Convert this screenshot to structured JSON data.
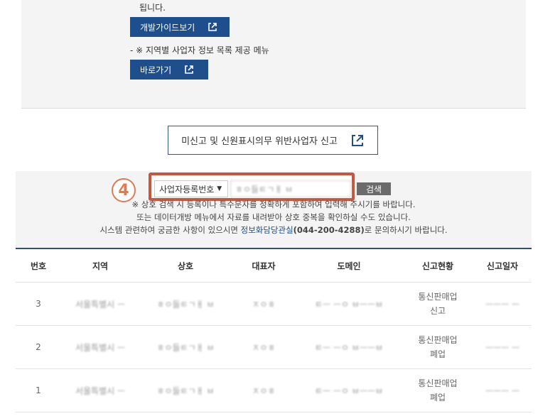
{
  "info": {
    "line_top": "됩니다.",
    "guide_button": "개발가이드보기",
    "list_note": "- ※ 지역별 사업자 정보 목록 제공 메뉴",
    "go_button": "바로가기"
  },
  "report_button": "미신고 및 신원표시의무 위반사업자 신고",
  "search": {
    "step_number": "4",
    "select_value": "사업자등록번호",
    "input_value": "ㅎㅇ들ㅌㄱㅐ ㅂ",
    "button": "검색"
  },
  "notices": [
    "※ 상호 검색 시 등록이나 특수문자를 정확하게 포함하여 입력해 주시기를 바랍니다.",
    "또는 데이터개방 메뉴에서 자료를 내려받아 상호 중복을 확인하실 수도 있습니다."
  ],
  "contact": {
    "prefix": "시스템 관련하여 궁금한 사항이 있으시면 ",
    "link": "정보화담당관실",
    "phone": "(044-200-4288)",
    "suffix": "로 문의하시기 바랍니다."
  },
  "table": {
    "headers": [
      "번호",
      "지역",
      "상호",
      "대표자",
      "도메인",
      "신고현황",
      "신고일자"
    ],
    "rows": [
      {
        "no": "3",
        "region": "서울특별시 ㅡ",
        "name": "ㅎㅇ들ㅌㄱㅐ ㅂ",
        "rep": "ㅈㅇㅎ",
        "domain": "ㅌㅡ ㅡㅇ ㅂㅡㅡㅂ",
        "status1": "통신판매업",
        "status2": "신고",
        "date": "ㅡㅡㅡ ㅡ"
      },
      {
        "no": "2",
        "region": "서울특별시 ㅡ",
        "name": "ㅎㅇ들ㅌㄱㅐ ㅂ",
        "rep": "ㅈㅇㅎ",
        "domain": "ㅌㅡ ㅡㅇ ㅂㅡㅡㅂ",
        "status1": "통신판매업",
        "status2": "폐업",
        "date": "ㅡㅡㅡ ㅡ"
      },
      {
        "no": "1",
        "region": "서울특별시 ㅡ",
        "name": "ㅎㅇ들ㅌㄱㅐ ㅂ",
        "rep": "ㅈㅇㅎ",
        "domain": "ㅌㅡ ㅡㅇ ㅂㅡㅡㅂ",
        "status1": "통신판매업",
        "status2": "폐업",
        "date": "ㅡㅡㅡ ㅡ"
      }
    ]
  },
  "colors": {
    "accent": "#1f4e8c",
    "highlight": "#c8553d",
    "step": "#e07a52"
  }
}
